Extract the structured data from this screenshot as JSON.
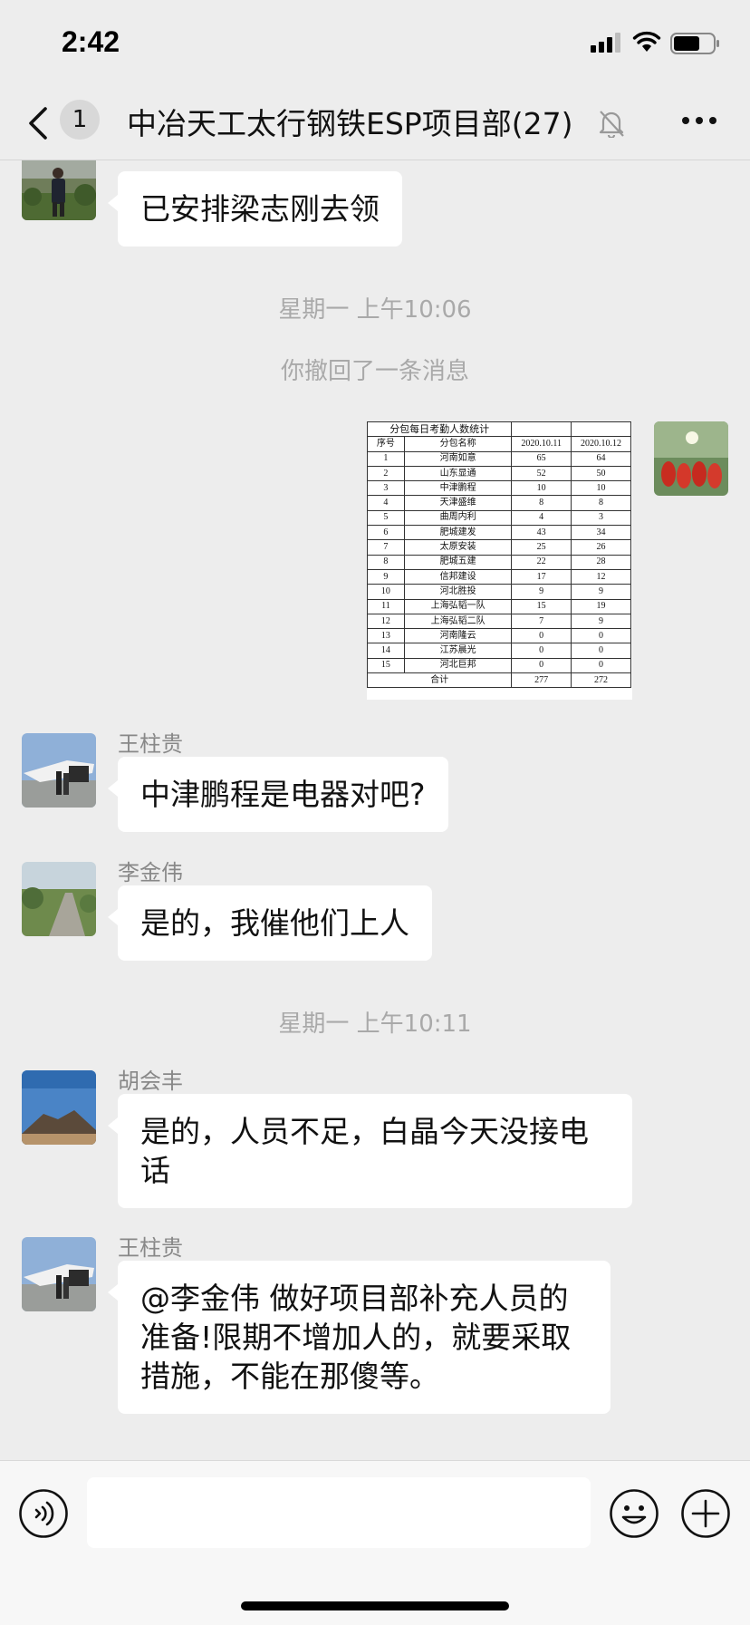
{
  "status_bar": {
    "time": "2:42"
  },
  "header": {
    "unread_count": "1",
    "title": "中冶天工太行钢铁ESP项目部(27)"
  },
  "messages": [
    {
      "type": "text",
      "sender": "",
      "text": "已安排梁志刚去领"
    },
    {
      "type": "time",
      "text": "星期一 上午10:06"
    },
    {
      "type": "system",
      "text": "你撤回了一条消息"
    },
    {
      "type": "image_table",
      "title": "分包每日考勤人数统计",
      "columns": [
        "序号",
        "分包名称",
        "2020.10.11",
        "2020.10.12"
      ],
      "rows": [
        [
          "1",
          "河南如意",
          "65",
          "64"
        ],
        [
          "2",
          "山东显通",
          "52",
          "50"
        ],
        [
          "3",
          "中津鹏程",
          "10",
          "10"
        ],
        [
          "4",
          "天津盛维",
          "8",
          "8"
        ],
        [
          "5",
          "曲周内利",
          "4",
          "3"
        ],
        [
          "6",
          "肥城建发",
          "43",
          "34"
        ],
        [
          "7",
          "太原安装",
          "25",
          "26"
        ],
        [
          "8",
          "肥城五建",
          "22",
          "28"
        ],
        [
          "9",
          "信邦建设",
          "17",
          "12"
        ],
        [
          "10",
          "河北胜投",
          "9",
          "9"
        ],
        [
          "11",
          "上海弘韬一队",
          "15",
          "19"
        ],
        [
          "12",
          "上海弘韬二队",
          "7",
          "9"
        ],
        [
          "13",
          "河南隆云",
          "0",
          "0"
        ],
        [
          "14",
          "江苏晨光",
          "0",
          "0"
        ],
        [
          "15",
          "河北巨邦",
          "0",
          "0"
        ]
      ],
      "total": [
        "合计",
        "277",
        "272"
      ]
    },
    {
      "type": "text",
      "sender": "王柱贵",
      "text": "中津鹏程是电器对吧?"
    },
    {
      "type": "text",
      "sender": "李金伟",
      "text": "是的，我催他们上人"
    },
    {
      "type": "time",
      "text": "星期一 上午10:11"
    },
    {
      "type": "text",
      "sender": "胡会丰",
      "text": "是的，人员不足，白晶今天没接电话"
    },
    {
      "type": "text",
      "sender": "王柱贵",
      "text": "@李金伟 做好项目部补充人员的准备!限期不增加人的，就要采取措施，不能在那傻等。"
    }
  ],
  "input": {
    "value": ""
  }
}
